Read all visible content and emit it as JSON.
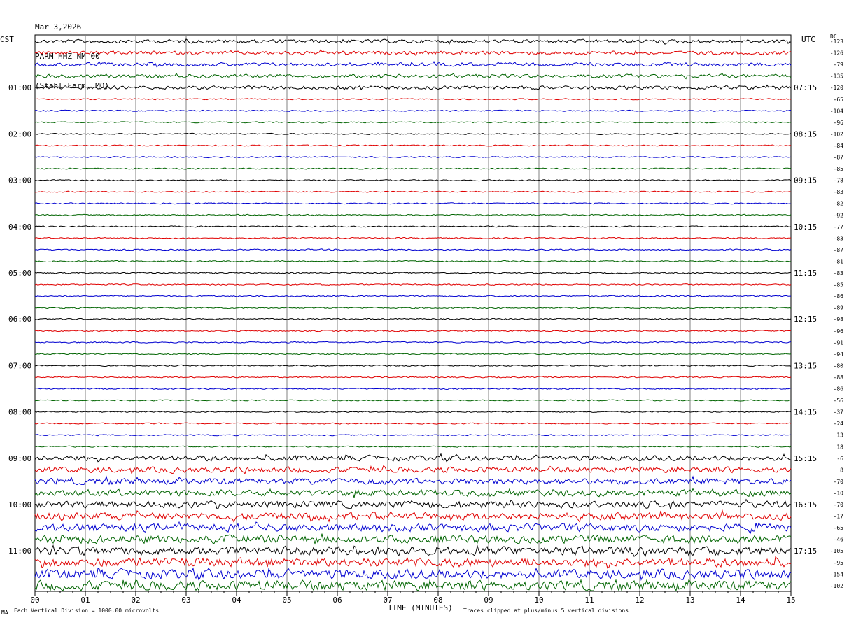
{
  "header": {
    "date": "Mar 3,2026",
    "station": "PARM HHZ NM 00",
    "location": "(Stahl Farm, MO)"
  },
  "left_tz": "CST",
  "right_tz": "UTC",
  "dc_label": "DC",
  "footer": {
    "scale_note": "Each Vertical Division = 1000.00 microvolts",
    "clip_note": "Traces clipped at plus/minus 5 vertical divisions",
    "mark": "MA"
  },
  "colors": {
    "trace_cycle": [
      "#000000",
      "#e00000",
      "#0000d0",
      "#006400"
    ],
    "grid": "#808080",
    "frame": "#000000"
  },
  "chart_data": {
    "type": "line",
    "title": "PARM HHZ NM 00",
    "xlabel": "TIME (MINUTES)",
    "ylabel": "",
    "xlim": [
      0,
      15
    ],
    "x_ticks": [
      "00",
      "01",
      "02",
      "03",
      "04",
      "05",
      "06",
      "07",
      "08",
      "09",
      "10",
      "11",
      "12",
      "13",
      "14",
      "15"
    ],
    "row_minutes": 15,
    "row_count": 48,
    "left_time_labels": [
      {
        "row": 4,
        "text": "01:00"
      },
      {
        "row": 8,
        "text": "02:00"
      },
      {
        "row": 12,
        "text": "03:00"
      },
      {
        "row": 16,
        "text": "04:00"
      },
      {
        "row": 20,
        "text": "05:00"
      },
      {
        "row": 24,
        "text": "06:00"
      },
      {
        "row": 28,
        "text": "07:00"
      },
      {
        "row": 32,
        "text": "08:00"
      },
      {
        "row": 36,
        "text": "09:00"
      },
      {
        "row": 40,
        "text": "10:00"
      },
      {
        "row": 44,
        "text": "11:00"
      }
    ],
    "right_time_labels": [
      {
        "row": 4,
        "text": "07:15"
      },
      {
        "row": 8,
        "text": "08:15"
      },
      {
        "row": 12,
        "text": "09:15"
      },
      {
        "row": 16,
        "text": "10:15"
      },
      {
        "row": 20,
        "text": "11:15"
      },
      {
        "row": 24,
        "text": "12:15"
      },
      {
        "row": 28,
        "text": "13:15"
      },
      {
        "row": 32,
        "text": "14:15"
      },
      {
        "row": 36,
        "text": "15:15"
      },
      {
        "row": 40,
        "text": "16:15"
      },
      {
        "row": 44,
        "text": "17:15"
      }
    ],
    "dc_offsets": [
      "-123",
      "-126",
      "-79",
      "-135",
      "-120",
      "-65",
      "-104",
      "-96",
      "-102",
      "-84",
      "-87",
      "-85",
      "-78",
      "-83",
      "-82",
      "-92",
      "-77",
      "-83",
      "-87",
      "-81",
      "-83",
      "-85",
      "-86",
      "-89",
      "-98",
      "-96",
      "-91",
      "-94",
      "-80",
      "-88",
      "-86",
      "-56",
      "-37",
      "-24",
      "13",
      "18",
      "-6",
      "8",
      "-70",
      "-10",
      "-70",
      "-17",
      "-65",
      "-46",
      "-105",
      "-95",
      "-154",
      "-102"
    ],
    "activity_rows": [
      0,
      1,
      2,
      3,
      4,
      36,
      37,
      38,
      39,
      40,
      41,
      42,
      43,
      44,
      45,
      46,
      47
    ],
    "clip_divisions": 5
  }
}
